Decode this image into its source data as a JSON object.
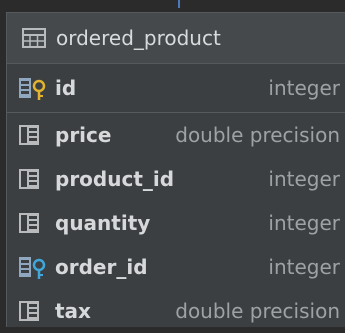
{
  "entity": {
    "title": "ordered_product",
    "table_icon": "table-icon",
    "primary_key": {
      "name": "id",
      "type": "integer",
      "icon": "primary-key-column-icon"
    },
    "columns": [
      {
        "name": "price",
        "type": "double precision",
        "icon": "column-icon"
      },
      {
        "name": "product_id",
        "type": "integer",
        "icon": "column-icon"
      },
      {
        "name": "quantity",
        "type": "integer",
        "icon": "column-icon"
      },
      {
        "name": "order_id",
        "type": "integer",
        "icon": "foreign-key-column-icon"
      },
      {
        "name": "tax",
        "type": "double precision",
        "icon": "column-icon"
      }
    ]
  },
  "colors": {
    "background": "#2b2b2b",
    "panel": "#3c3f41",
    "header": "#45494b",
    "primary_key": "#e2b32e",
    "foreign_key": "#3fa7db",
    "column_icon": "#b8babc"
  }
}
